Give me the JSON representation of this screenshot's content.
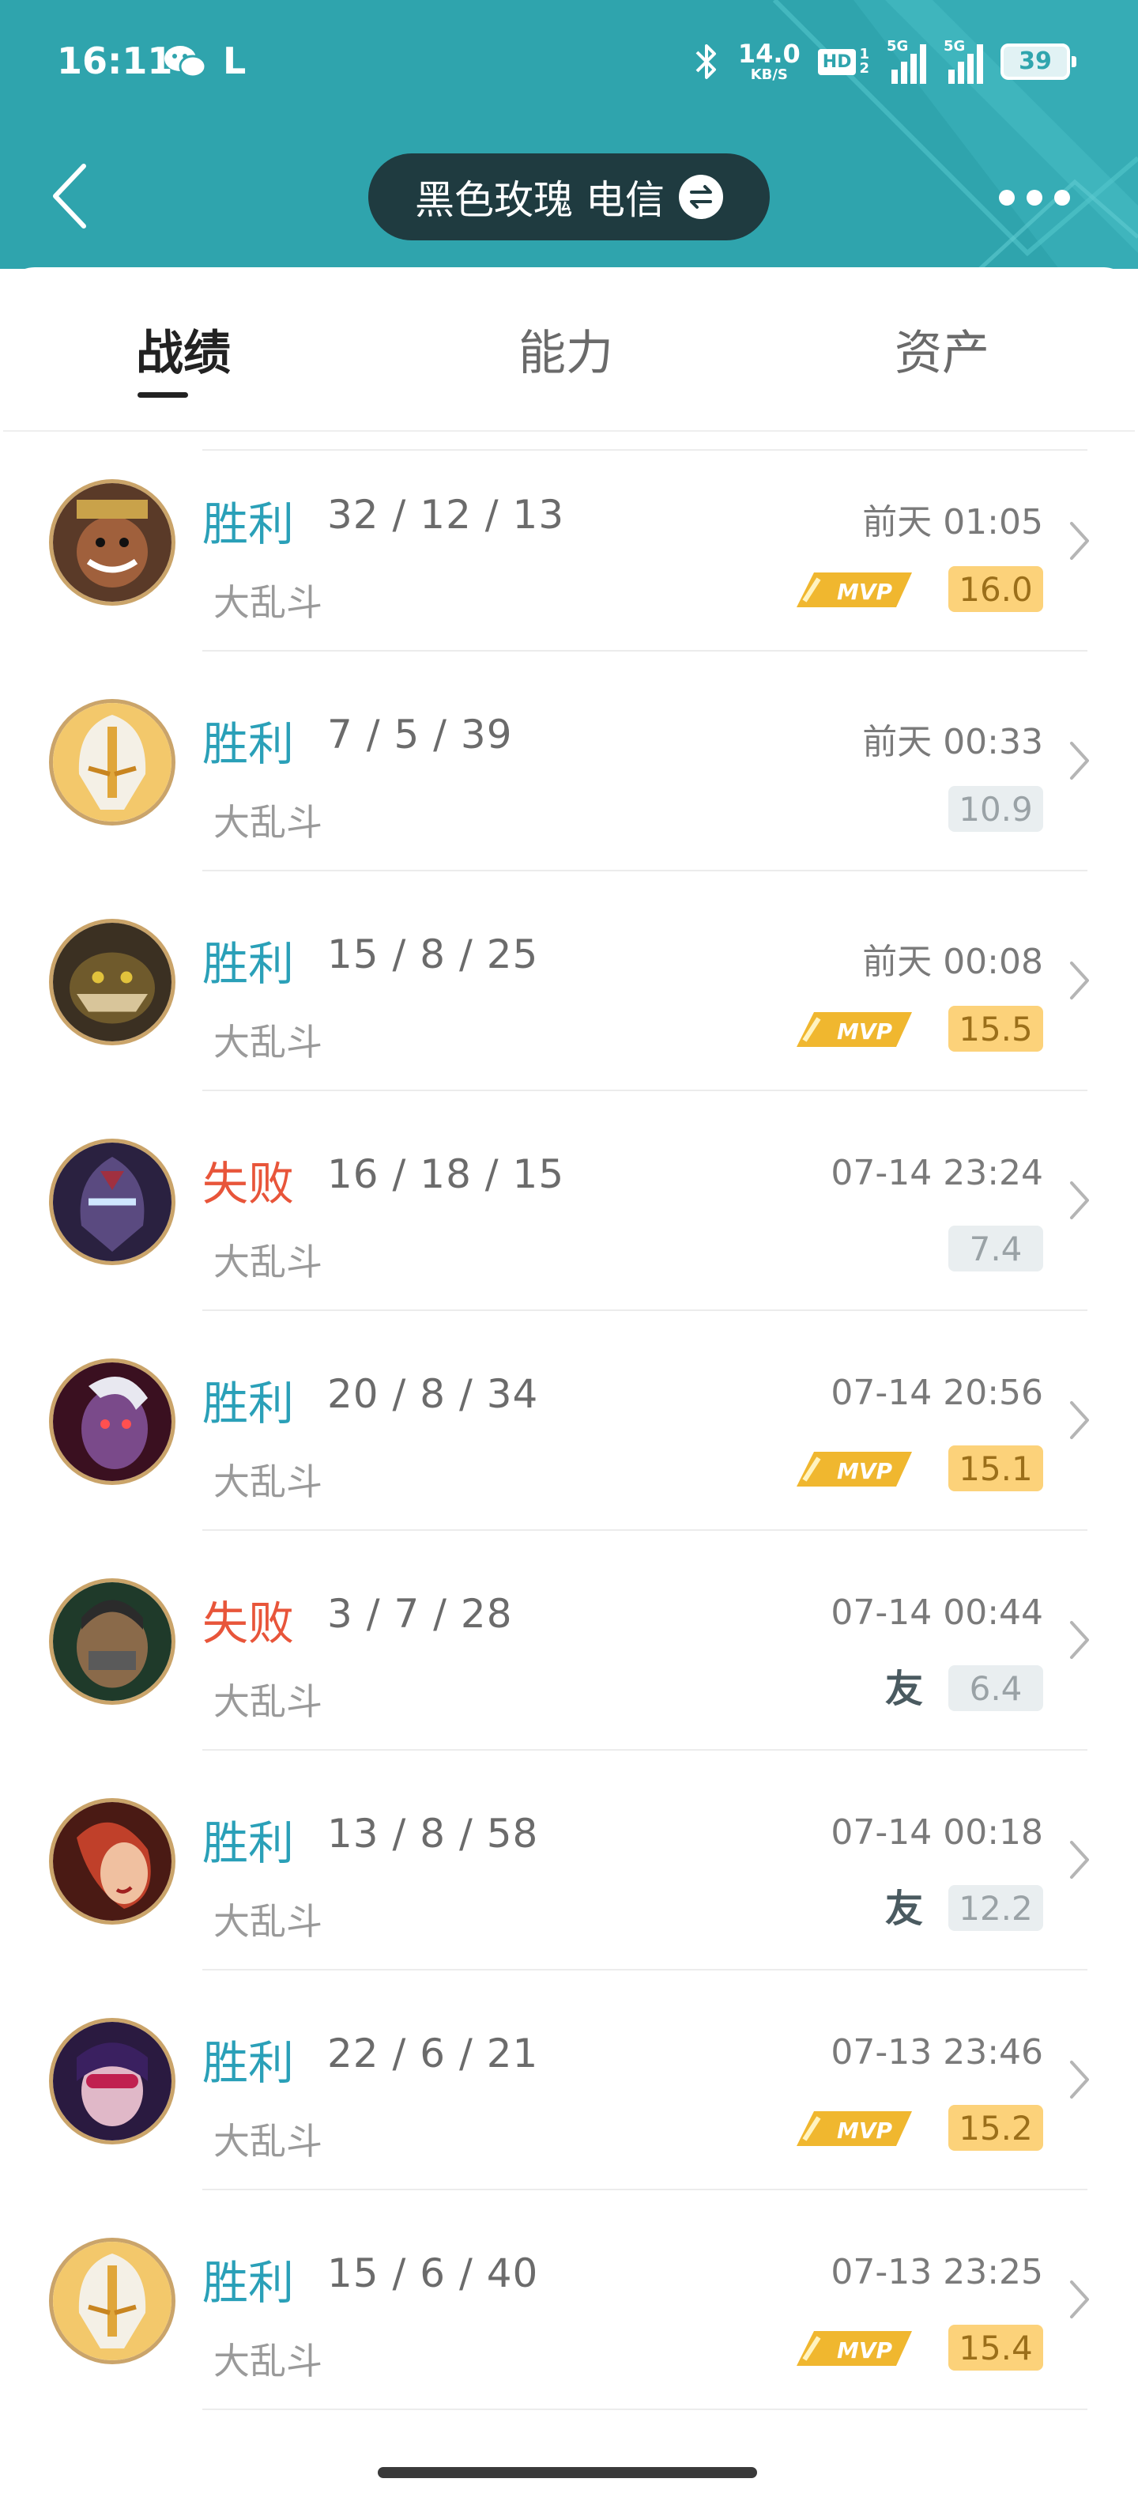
{
  "status_bar": {
    "time": "16:11",
    "carrier_letter": "L",
    "speed_value": "14.0",
    "speed_unit": "KB/S",
    "hd_label": "HD",
    "hd_sub": "1\n2",
    "signal1_label": "5G",
    "signal2_label": "5G",
    "battery": "39"
  },
  "nav": {
    "account_name": "黑色玫瑰 电信",
    "icons": [
      "back-arrow",
      "swap-icon",
      "more-icon"
    ]
  },
  "tabs": [
    {
      "label": "战绩",
      "active": true
    },
    {
      "label": "能力",
      "active": false
    },
    {
      "label": "资产",
      "active": false
    }
  ],
  "colors": {
    "header": "#2fa4ad",
    "win": "#2aa0b8",
    "loss": "#e8553a",
    "mvp_score_bg": "#fcd27a",
    "score_bg": "#e9eef0"
  },
  "matches": [
    {
      "result": "胜利",
      "outcome": "win",
      "kda": "32 / 12 / 13",
      "mode": "大乱斗",
      "time": "前天 01:05",
      "badge": "mvp",
      "badge_text": "MVP",
      "score": "16.0",
      "champion": "darius"
    },
    {
      "result": "胜利",
      "outcome": "win",
      "kda": "7 / 5 / 39",
      "mode": "大乱斗",
      "time": "前天 00:33",
      "badge": "none",
      "badge_text": "",
      "score": "10.9",
      "champion": "helmet-gold"
    },
    {
      "result": "胜利",
      "outcome": "win",
      "kda": "15 / 8 / 25",
      "mode": "大乱斗",
      "time": "前天 00:08",
      "badge": "mvp",
      "badge_text": "MVP",
      "score": "15.5",
      "champion": "renekton"
    },
    {
      "result": "失败",
      "outcome": "loss",
      "kda": "16 / 18 / 15",
      "mode": "大乱斗",
      "time": "07-14 23:24",
      "badge": "none",
      "badge_text": "",
      "score": "7.4",
      "champion": "kassadin"
    },
    {
      "result": "胜利",
      "outcome": "win",
      "kda": "20 / 8 / 34",
      "mode": "大乱斗",
      "time": "07-14 20:56",
      "badge": "mvp",
      "badge_text": "MVP",
      "score": "15.1",
      "champion": "varus"
    },
    {
      "result": "失败",
      "outcome": "loss",
      "kda": "3 / 7 / 28",
      "mode": "大乱斗",
      "time": "07-14 00:44",
      "badge": "friend",
      "badge_text": "友",
      "score": "6.4",
      "champion": "samira"
    },
    {
      "result": "胜利",
      "outcome": "win",
      "kda": "13 / 8 / 58",
      "mode": "大乱斗",
      "time": "07-14 00:18",
      "badge": "friend",
      "badge_text": "友",
      "score": "12.2",
      "champion": "miss-fortune"
    },
    {
      "result": "胜利",
      "outcome": "win",
      "kda": "22 / 6 / 21",
      "mode": "大乱斗",
      "time": "07-13 23:46",
      "badge": "mvp",
      "badge_text": "MVP",
      "score": "15.2",
      "champion": "vayne"
    },
    {
      "result": "胜利",
      "outcome": "win",
      "kda": "15 / 6 / 40",
      "mode": "大乱斗",
      "time": "07-13 23:25",
      "badge": "mvp",
      "badge_text": "MVP",
      "score": "15.4",
      "champion": "helmet-gold"
    }
  ]
}
